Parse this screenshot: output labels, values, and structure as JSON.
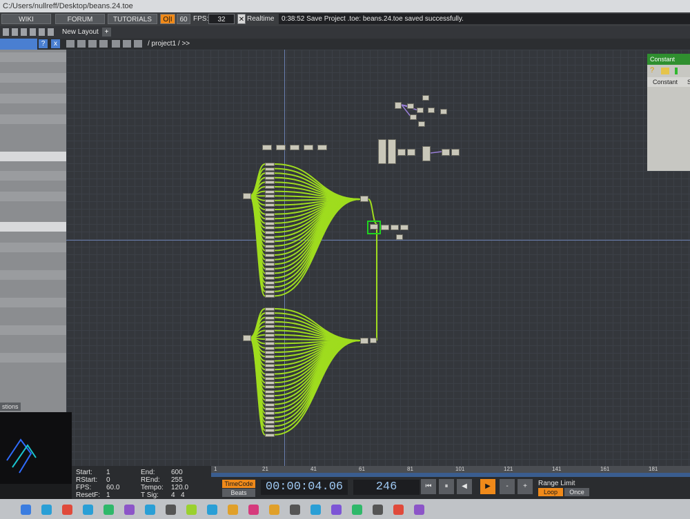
{
  "window": {
    "title_path": "C:/Users/nullreff/Desktop/beans.24.toe"
  },
  "topbar": {
    "wiki": "WIKI",
    "forum": "FORUM",
    "tutorials": "TUTORIALS",
    "oi": "O|I",
    "sixty": "60",
    "fps_label": "FPS:",
    "fps_value": "32",
    "realtime": "Realtime",
    "status": "0:38:52 Save Project .toe: beans.24.toe saved successfully."
  },
  "layout": {
    "new_layout": "New Layout",
    "add": "+"
  },
  "pane": {
    "help": "?",
    "close": "x",
    "path": "/ project1 / >>"
  },
  "parampanel": {
    "title": "Constant",
    "tab": "Constant",
    "tab2": "S",
    "help": "?"
  },
  "viewer": {
    "label": "stions"
  },
  "timeline": {
    "start_label": "Start:",
    "start": "1",
    "end_label": "End:",
    "end": "600",
    "rstart_label": "RStart:",
    "rstart": "0",
    "rend_label": "REnd:",
    "rend": "255",
    "fps_label": "FPS:",
    "fps": "60.0",
    "tempo_label": "Tempo:",
    "tempo": "120.0",
    "resetf_label": "ResetF:",
    "resetf": "1",
    "tsig_label": "T Sig:",
    "tsig_a": "4",
    "tsig_b": "4",
    "ruler": [
      "1",
      "21",
      "41",
      "61",
      "81",
      "101",
      "121",
      "141",
      "161",
      "181"
    ],
    "timecode": "TimeCode",
    "beats": "Beats",
    "time": "00:00:04.06",
    "frame": "246",
    "range_limit": "Range Limit",
    "loop": "Loop",
    "once": "Once"
  },
  "colors": {
    "wire": "#9fdc1e",
    "accent": "#f08a1a",
    "selected": "#1fd41f"
  }
}
